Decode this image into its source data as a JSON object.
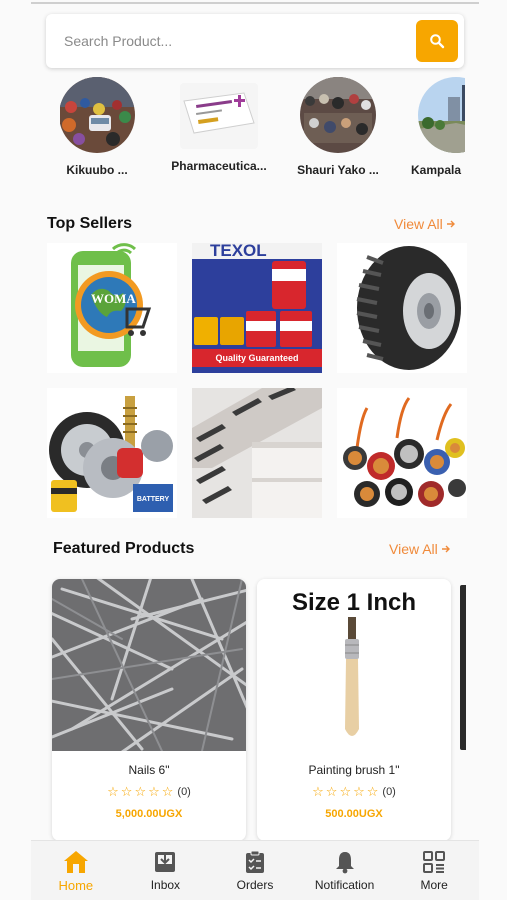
{
  "search": {
    "placeholder": "Search Product..."
  },
  "categories": [
    {
      "label": "Kikuubo  ..."
    },
    {
      "label": "Pharmaceutica..."
    },
    {
      "label": "Shauri Yako ..."
    },
    {
      "label": "Kampala"
    }
  ],
  "top_sellers": {
    "title": "Top Sellers",
    "view_all": "View All",
    "tiles": [
      {
        "name": "woma-logo",
        "text": "WOMA"
      },
      {
        "name": "texol-paints",
        "brand": "TEXOL",
        "banner": "Quality Guaranteed"
      },
      {
        "name": "tyre"
      },
      {
        "name": "auto-parts",
        "text": "BATTERY"
      },
      {
        "name": "display-shelves"
      },
      {
        "name": "electric-cables"
      }
    ]
  },
  "featured": {
    "title": "Featured Products",
    "view_all": "View All",
    "products": [
      {
        "name": "Nails 6\"",
        "rating_count": "(0)",
        "price": "5,000.00UGX"
      },
      {
        "name": "Painting brush 1\"",
        "rating_count": "(0)",
        "price": "500.00UGX",
        "image_caption": "Size 1 Inch"
      }
    ]
  },
  "nav": [
    {
      "label": "Home",
      "icon": "home-icon",
      "active": true
    },
    {
      "label": "Inbox",
      "icon": "inbox-icon"
    },
    {
      "label": "Orders",
      "icon": "orders-icon"
    },
    {
      "label": "Notification",
      "icon": "bell-icon"
    },
    {
      "label": "More",
      "icon": "more-grid-icon"
    }
  ],
  "colors": {
    "accent": "#f7a600",
    "view_all": "#f08a3a"
  }
}
